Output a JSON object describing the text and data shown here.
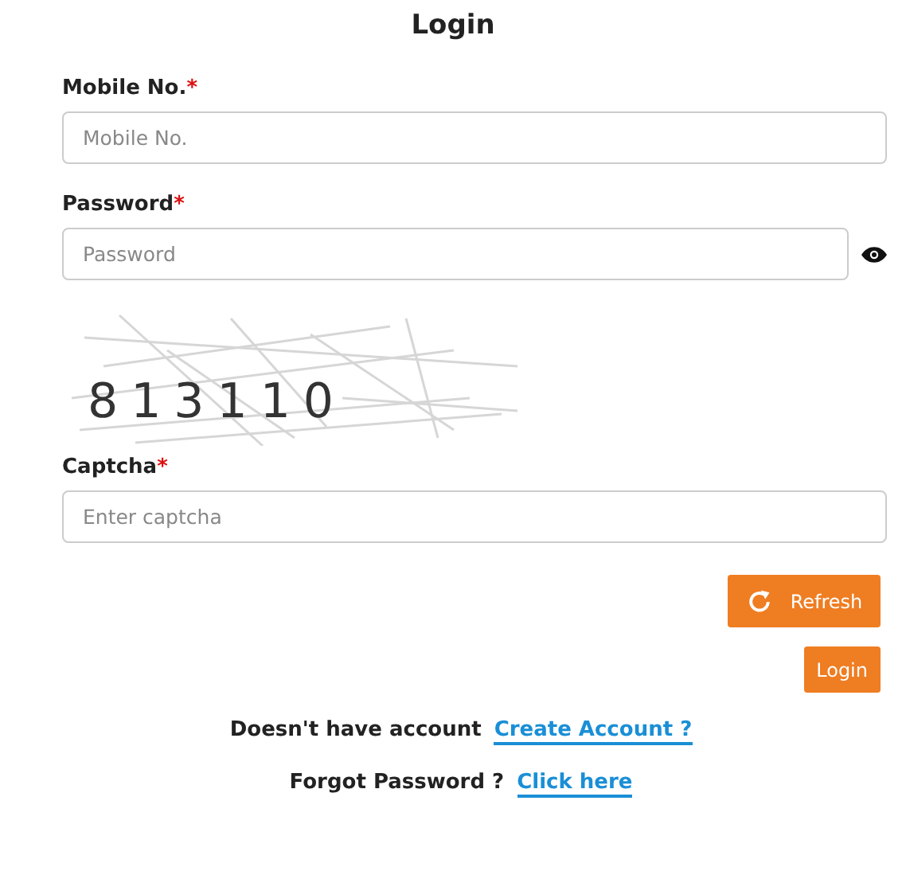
{
  "title": "Login",
  "fields": [
    {
      "label": "Mobile No.",
      "required_mark": "*",
      "placeholder": "Mobile No.",
      "kind": "text"
    },
    {
      "label": "Password",
      "required_mark": "*",
      "placeholder": "Password",
      "kind": "password"
    }
  ],
  "captcha": {
    "digits": "813110",
    "label": "Captcha",
    "required_mark": "*",
    "placeholder": "Enter captcha"
  },
  "refresh_button": "Refresh",
  "login_button": "Login",
  "links": [
    {
      "text": "Doesn't have account",
      "link": "Create Account ?"
    },
    {
      "text": "Forgot Password ?",
      "link": "Click here"
    }
  ]
}
